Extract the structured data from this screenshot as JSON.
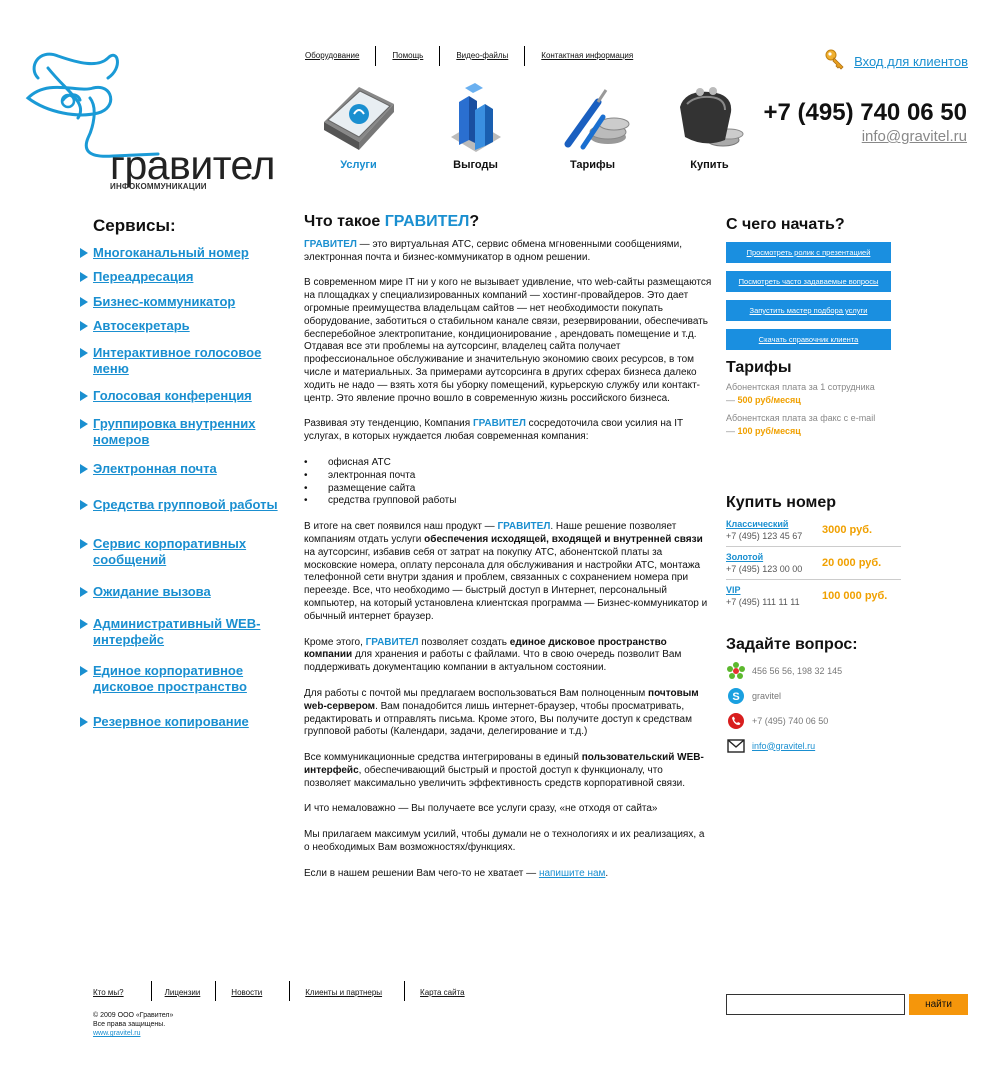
{
  "logo": {
    "name": "гравител",
    "subtitle": "ИНФОКОММУНИКАЦИИ"
  },
  "topnav": [
    "Оборудование",
    "Помощь",
    "Видео-файлы",
    "Контактная информация"
  ],
  "login": {
    "label": "Вход для клиентов",
    "icon": "key-icon"
  },
  "phone": "+7 (495) 740 06 50",
  "email": "info@gravitel.ru",
  "mainnav": [
    {
      "label": "Услуги",
      "icon": "book-icon",
      "active": true
    },
    {
      "label": "Выгоды",
      "icon": "bar-chart-icon",
      "active": false
    },
    {
      "label": "Тарифы",
      "icon": "tools-coins-icon",
      "active": false
    },
    {
      "label": "Купить",
      "icon": "wallet-icon",
      "active": false
    }
  ],
  "services": {
    "title": "Сервисы:",
    "items": [
      "Многоканальный номер",
      "Переадресация",
      "Бизнес-коммуникатор",
      "Автосекретарь",
      "Интерактивное голосовое меню",
      "Голосовая конференция",
      "Группировка внутренних номеров",
      "Электронная почта",
      "Средства групповой работы",
      "Сервис корпоративных сообщений",
      "Ожидание вызова",
      "Административный WEB-интерфейс",
      "Единое корпоративное дисковое пространство",
      "Резервное копирование"
    ]
  },
  "content": {
    "title_prefix": "Что такое ",
    "title_brand": "ГРАВИТЕЛ",
    "title_suffix": "?",
    "brand": "ГРАВИТЕЛ",
    "p1": " — это виртуальная АТС,  сервис обмена мгновенными сообщениями, электронная почта  и бизнес-коммуникатор в одном решении.",
    "p2": "В современном мире IT ни у кого не вызывает удивление, что web-сайты размещаются на площадках у специализированных компаний — хостинг-провайдеров. Это дает огромные преимущества владельцам сайтов — нет необходимости покупать оборудование, заботиться о стабильном канале связи, резервировании, обеспечивать бесперебойное электропитание, кондиционирование , арендовать помещение и т.д.  Отдавая все эти проблемы на аутсорсинг, владелец сайта получает профессиональное обслуживание и значительную экономию своих ресурсов, в том числе и материальных. За примерами аутсорсинга в других сферах бизнеса далеко ходить не надо — взять хотя бы уборку помещений, курьерскую службу или контакт-центр.   Это явление прочно вошло в  современную жизнь российского  бизнеса.",
    "p3_a": "Развивая эту тенденцию, Компания ",
    "p3_b": "  сосредоточила свои усилия на IT услугах, в которых нуждается любая современная компания:",
    "list": [
      "офисная АТС",
      "электронная почта",
      "размещение сайта",
      "средства групповой работы"
    ],
    "p4_a": "В итоге на свет появился  наш продукт — ",
    "p4_b": ".  Наше решение позволяет компаниям отдать услуги ",
    "p4_bold": "обеспечения исходящей, входящей и внутренней связи",
    "p4_c": " на аутсорсинг,  избавив себя от затрат на покупку АТС, абонентской платы за московские номера,  оплату персонала для обслуживания и настройки АТС, монтажа телефонной сети внутри здания и проблем, связанных с сохранением номера при переезде.  Все, что необходимо  — быстрый доступ в Интернет, персональный компьютер, на который установлена клиентская программа — Бизнес-коммуникатор и обычный интернет браузер.",
    "p5_a": "Кроме этого,  ",
    "p5_b": " позволяет создать ",
    "p5_bold": "единое дисковое пространство компании",
    "p5_c": " для хранения и работы с файлами. Что в свою очередь позволит Вам поддерживать документацию компании в актуальном  состоянии.",
    "p6_a": "Для работы с почтой мы предлагаем воспользоваться Вам полноценным ",
    "p6_bold": "почтовым web-сервером",
    "p6_c": ". Вам понадобится лишь интернет-браузер, чтобы просматривать, редактировать и отправлять письма. Кроме этого, Вы получите доступ к средствам групповой работы (Календари, задачи, делегирование и т.д.)",
    "p7_a": "Все коммуникационные средства интегрированы в единый ",
    "p7_bold": "пользовательский WEB-интерфейс",
    "p7_c": ", обеспечивающий быстрый и простой доступ к  функционалу, что позволяет максимально увеличить эффективность средств корпоративной связи.",
    "p8": "И что немаловажно — Вы получаете все услуги сразу, «не отходя от сайта»",
    "p9": "Мы прилагаем максимум усилий, чтобы думали не о технологиях и их реализациях, а о необходимых Вам возможностях/функциях.",
    "p10_a": "Если в нашем решении Вам чего-то не хватает — ",
    "p10_link": "напишите нам",
    "p10_c": "."
  },
  "right": {
    "start_title": "С чего начать?",
    "buttons": [
      "Просмотреть ролик с презентацией",
      "Посмотреть часто задаваемые вопросы",
      "Запустить мастер подбора услуги",
      "Скачать справочник клиента"
    ],
    "tariffs_title": "Тарифы",
    "tariffs": [
      {
        "text": "Абонентская плата за 1 сотрудника",
        "price": "500 руб/месяц"
      },
      {
        "text": "Абонентская плата за факс с e-mail",
        "price": "100 руб/месяц"
      }
    ],
    "buy_title": "Купить номер",
    "numbers": [
      {
        "name": "Классический",
        "number": "+7 (495) 123 45 67",
        "price": "3000 руб."
      },
      {
        "name": "Золотой",
        "number": "+7 (495) 123 00 00",
        "price": "20 000 руб."
      },
      {
        "name": "VIP",
        "number": "+7 (495) 111 11 11",
        "price": "100 000 руб."
      }
    ],
    "ask_title": "Задайте вопрос:",
    "contacts": [
      {
        "icon": "icq-icon",
        "text": "456 56 56, 198 32 145"
      },
      {
        "icon": "skype-icon",
        "text": "gravitel"
      },
      {
        "icon": "phone-icon",
        "text": "+7 (495) 740 06 50"
      },
      {
        "icon": "envelope-icon",
        "text": "info@gravitel.ru"
      }
    ]
  },
  "footer": {
    "nav": [
      "Кто мы?",
      "Лицензии",
      "Новости",
      "Клиенты и партнеры",
      "Карта сайта"
    ],
    "copyright_1": "© 2009 ООО «Гравител»",
    "copyright_2": "Все права защищены.",
    "site": "www.gravitel.ru"
  },
  "search": {
    "placeholder": "",
    "button": "найти"
  },
  "colors": {
    "accent": "#1a8fd0",
    "orange": "#f5960b",
    "price": "#f0a000"
  }
}
